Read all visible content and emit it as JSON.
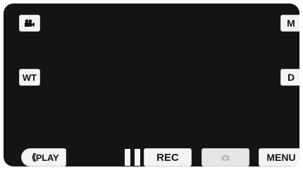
{
  "controls": {
    "top_left_icon": "video-camera-icon",
    "top_right_label": "M",
    "mid_left_label": "WT",
    "mid_right_label": "D"
  },
  "bottom_bar": {
    "play_label": "PLAY",
    "play_icon": "double-chevron-left-icon",
    "pause_icon": "pause-icon",
    "rec_label": "REC",
    "snapshot_icon": "camera-icon",
    "menu_label": "MENU"
  }
}
